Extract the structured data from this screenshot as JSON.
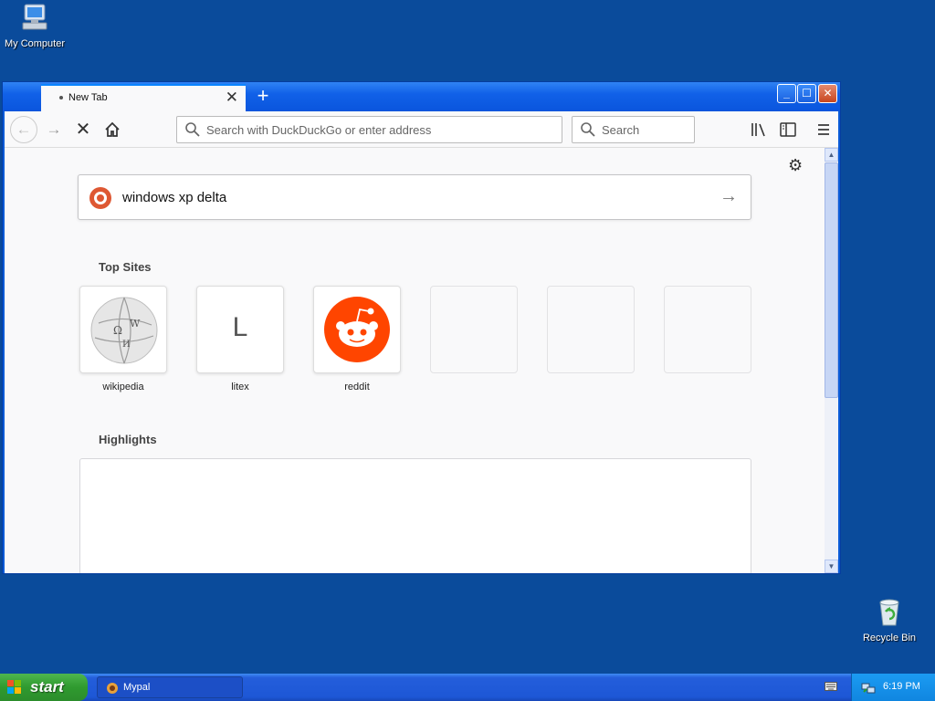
{
  "desktop": {
    "my_computer_label": "My Computer",
    "recycle_bin_label": "Recycle Bin"
  },
  "browser": {
    "tab_title": "New Tab",
    "url_placeholder": "Search with DuckDuckGo or enter address",
    "search_placeholder": "Search"
  },
  "newtab": {
    "search_value": "windows xp delta",
    "top_sites_title": "Top Sites",
    "highlights_title": "Highlights",
    "sites": [
      {
        "label": "wikipedia"
      },
      {
        "label": "litex",
        "letter": "L"
      },
      {
        "label": "reddit"
      }
    ]
  },
  "taskbar": {
    "start_label": "start",
    "task_label": "Mypal",
    "clock": "6:19 PM"
  },
  "colors": {
    "desktop": "#0a4b9b",
    "reddit": "#ff4500",
    "duckduckgo": "#de5833",
    "accent": "#0a84ff"
  }
}
